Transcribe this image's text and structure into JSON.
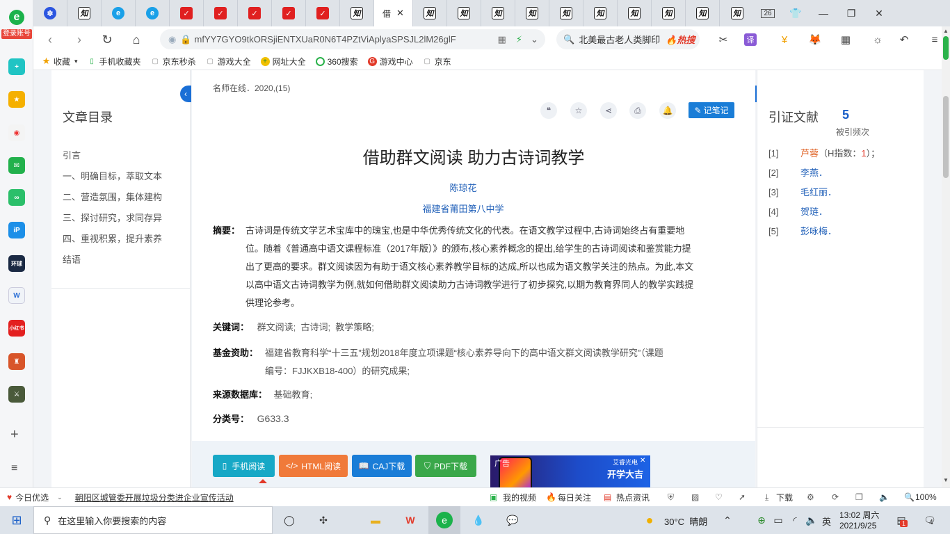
{
  "rail": {
    "login_label": "登录账号"
  },
  "tabs": {
    "active_label": "借",
    "badge": "26"
  },
  "address": {
    "url": "mfYY7GYO9tkORSjiENTXUaR0N6T4PZtViAplyaSPSJL2lM26glF",
    "search_text": "北美最古老人类脚印",
    "hot_label": "热搜"
  },
  "bookmarks": [
    {
      "label": "收藏"
    },
    {
      "label": "手机收藏夹"
    },
    {
      "label": "京东秒杀"
    },
    {
      "label": "游戏大全"
    },
    {
      "label": "网址大全"
    },
    {
      "label": "360搜索"
    },
    {
      "label": "游戏中心"
    },
    {
      "label": "京东"
    }
  ],
  "toc": {
    "title": "文章目录",
    "items": [
      "引言",
      "一、明确目标，萃取文本",
      "二、营造氛围，集体建构",
      "三、探讨研究，求同存异",
      "四、重视积累，提升素养",
      "结语"
    ]
  },
  "article": {
    "source": "名师在线．2020,(15)",
    "note_button": "记笔记",
    "title": "借助群文阅读 助力古诗词教学",
    "author": "陈琼花",
    "org": "福建省莆田第八中学",
    "abstract_label": "摘要：",
    "abstract_lines": [
      "古诗词是传统文学艺术宝库中的瑰宝,也是中华优秀传统文化的代表。在语文教学过程中,古诗词始终占有重要地",
      "位。随着《普通高中语文课程标准（2017年版）》的颁布,核心素养概念的提出,给学生的古诗词阅读和鉴赏能力提",
      "出了更高的要求。群文阅读因为有助于语文核心素养教学目标的达成,所以也成为语文教学关注的热点。为此,本文",
      "以高中语文古诗词教学为例,就如何借助群文阅读助力古诗词教学进行了初步探究,以期为教育界同人的教学实践提",
      "供理论参考。"
    ],
    "keywords_label": "关键词：",
    "keywords": "群文阅读;  古诗词;  教学策略;",
    "fund_label": "基金资助：",
    "fund_lines": [
      "福建省教育科学“十三五”规划2018年度立项课题“核心素养导向下的高中语文群文阅读教学研究”（课题",
      "编号：FJJKXB18-400）的研究成果;"
    ],
    "db_label": "来源数据库：",
    "db": "基础教育;",
    "class_label": "分类号：",
    "class": "G633.3",
    "buttons": [
      "手机阅读",
      "HTML阅读",
      "CAJ下载",
      "PDF下载"
    ],
    "ad": {
      "left": "广告",
      "brand": "艾睿光电",
      "slogan": "开学大吉"
    }
  },
  "citations": {
    "title": "引证文献",
    "count": "5",
    "count_label": "被引频次",
    "items": [
      {
        "idx": "[1]",
        "name": "芦蓉",
        "extra_open": "（H指数：",
        "h": "1",
        "extra_close": "）；"
      },
      {
        "idx": "[2]",
        "name": "李燕．"
      },
      {
        "idx": "[3]",
        "name": "毛红丽．"
      },
      {
        "idx": "[4]",
        "name": "贺琏．"
      },
      {
        "idx": "[5]",
        "name": "彭咏梅．"
      }
    ]
  },
  "status": {
    "left1": "今日优选",
    "news": "朝阳区城管委开展垃圾分类进企业宣传活动",
    "video": "我的视频",
    "daily": "每日关注",
    "hot": "热点资讯",
    "download": "下载",
    "zoom": "100%"
  },
  "taskbar": {
    "search_placeholder": "在这里输入你要搜索的内容",
    "weather": "30°C  晴朗",
    "ime": "英",
    "time": "13:02 周六",
    "date": "2021/9/25",
    "notify": "4",
    "badge": "1"
  },
  "colors": {
    "accent": "#1a7dd7",
    "link": "#1f5fb8",
    "orange": "#e0662a",
    "teal": "#1aa3c2"
  }
}
